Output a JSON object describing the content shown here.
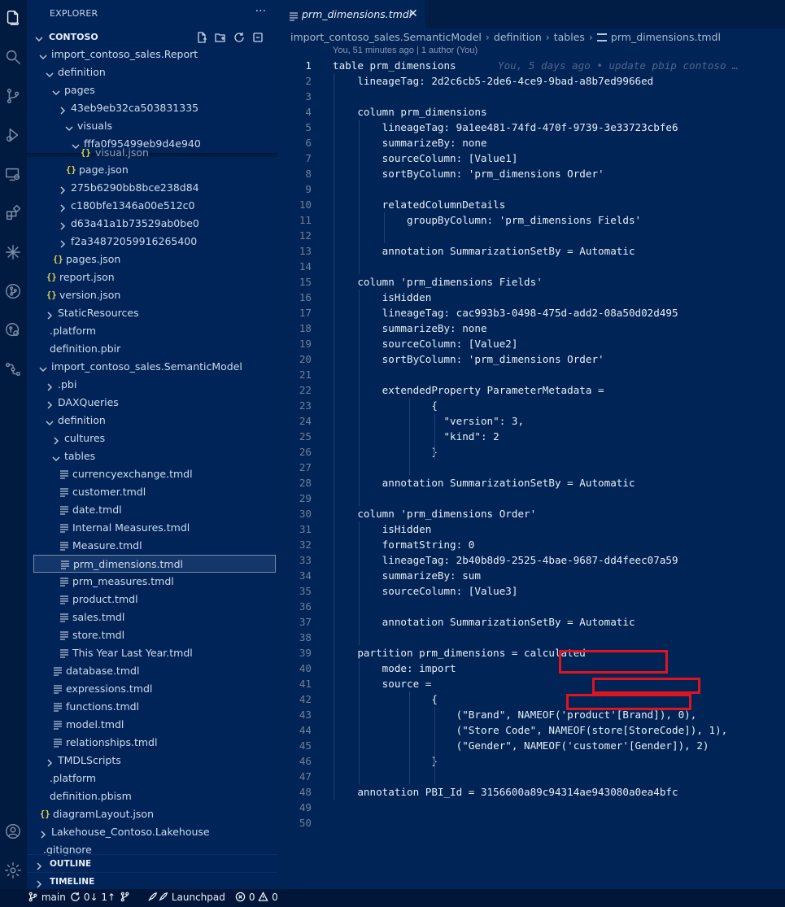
{
  "sidebar": {
    "title": "EXPLORER",
    "more": "···",
    "section_title": "CONTOSO",
    "tree": [
      {
        "label": "import_contoso_sales.Report",
        "type": "folder-open"
      },
      {
        "label": "definition",
        "type": "folder-open"
      },
      {
        "label": "pages",
        "type": "folder-open"
      },
      {
        "label": "43eb9eb32ca503831335",
        "type": "folder-closed"
      },
      {
        "label": "visuals",
        "type": "folder-open"
      },
      {
        "label": "fffa0f95499eb9d4e940",
        "type": "folder-open"
      },
      {
        "label": "page.json",
        "type": "json"
      },
      {
        "label": "275b6290bb8bce238d84",
        "type": "folder-closed"
      },
      {
        "label": "c180bfe1346a00e512c0",
        "type": "folder-closed"
      },
      {
        "label": "d63a41a1b73529ab0be0",
        "type": "folder-closed"
      },
      {
        "label": "f2a34872059916265400",
        "type": "folder-closed"
      },
      {
        "label": "pages.json",
        "type": "json"
      },
      {
        "label": "report.json",
        "type": "json"
      },
      {
        "label": "version.json",
        "type": "json"
      },
      {
        "label": "StaticResources",
        "type": "folder-closed"
      },
      {
        "label": ".platform",
        "type": "file"
      },
      {
        "label": "definition.pbir",
        "type": "file"
      },
      {
        "label": "import_contoso_sales.SemanticModel",
        "type": "folder-open"
      },
      {
        "label": ".pbi",
        "type": "folder-closed"
      },
      {
        "label": "DAXQueries",
        "type": "folder-closed"
      },
      {
        "label": "definition",
        "type": "folder-open"
      },
      {
        "label": "cultures",
        "type": "folder-closed"
      },
      {
        "label": "tables",
        "type": "folder-open"
      },
      {
        "label": "currencyexchange.tmdl",
        "type": "tmdl"
      },
      {
        "label": "customer.tmdl",
        "type": "tmdl"
      },
      {
        "label": "date.tmdl",
        "type": "tmdl"
      },
      {
        "label": "Internal Measures.tmdl",
        "type": "tmdl"
      },
      {
        "label": "Measure.tmdl",
        "type": "tmdl"
      },
      {
        "label": "prm_dimensions.tmdl",
        "type": "tmdl",
        "selected": true
      },
      {
        "label": "prm_measures.tmdl",
        "type": "tmdl"
      },
      {
        "label": "product.tmdl",
        "type": "tmdl"
      },
      {
        "label": "sales.tmdl",
        "type": "tmdl"
      },
      {
        "label": "store.tmdl",
        "type": "tmdl"
      },
      {
        "label": "This Year Last Year.tmdl",
        "type": "tmdl"
      },
      {
        "label": "database.tmdl",
        "type": "tmdl"
      },
      {
        "label": "expressions.tmdl",
        "type": "tmdl"
      },
      {
        "label": "functions.tmdl",
        "type": "tmdl"
      },
      {
        "label": "model.tmdl",
        "type": "tmdl"
      },
      {
        "label": "relationships.tmdl",
        "type": "tmdl"
      },
      {
        "label": "TMDLScripts",
        "type": "folder-closed"
      },
      {
        "label": ".platform",
        "type": "file"
      },
      {
        "label": "definition.pbism",
        "type": "file"
      },
      {
        "label": "diagramLayout.json",
        "type": "json"
      },
      {
        "label": "Lakehouse_Contoso.Lakehouse",
        "type": "folder-closed"
      },
      {
        "label": ".gitignore",
        "type": "file"
      }
    ],
    "peek_label": "visual.json",
    "outline": "OUTLINE",
    "timeline": "TIMELINE"
  },
  "editor": {
    "tab_label": "prm_dimensions.tmdl",
    "tab_close": "✕",
    "breadcrumb": [
      "import_contoso_sales.SemanticModel",
      "definition",
      "tables",
      "prm_dimensions.tmdl"
    ],
    "codelens": "You, 51 minutes ago | 1 author (You)",
    "blame": "You, 5 days ago • update pbip contoso …",
    "lines": [
      "table prm_dimensions",
      "    lineageTag: 2d2c6cb5-2de6-4ce9-9bad-a8b7ed9966ed",
      "",
      "    column prm_dimensions",
      "        lineageTag: 9a1ee481-74fd-470f-9739-3e33723cbfe6",
      "        summarizeBy: none",
      "        sourceColumn: [Value1]",
      "        sortByColumn: 'prm_dimensions Order'",
      "",
      "        relatedColumnDetails",
      "            groupByColumn: 'prm_dimensions Fields'",
      "",
      "        annotation SummarizationSetBy = Automatic",
      "",
      "    column 'prm_dimensions Fields'",
      "        isHidden",
      "        lineageTag: cac993b3-0498-475d-add2-08a50d02d495",
      "        summarizeBy: none",
      "        sourceColumn: [Value2]",
      "        sortByColumn: 'prm_dimensions Order'",
      "",
      "        extendedProperty ParameterMetadata =",
      "                {",
      "                  \"version\": 3,",
      "                  \"kind\": 2",
      "                }",
      "",
      "        annotation SummarizationSetBy = Automatic",
      "",
      "    column 'prm_dimensions Order'",
      "        isHidden",
      "        formatString: 0",
      "        lineageTag: 2b40b8d9-2525-4bae-9687-dd4feec07a59",
      "        summarizeBy: sum",
      "        sourceColumn: [Value3]",
      "",
      "        annotation SummarizationSetBy = Automatic",
      "",
      "    partition prm_dimensions = calculated",
      "        mode: import",
      "        source =",
      "                {",
      "                    (\"Brand\", NAMEOF('product'[Brand]), 0),",
      "                    (\"Store Code\", NAMEOF(store[StoreCode]), 1),",
      "                    (\"Gender\", NAMEOF('customer'[Gender]), 2)",
      "                }",
      "",
      "    annotation PBI_Id = 3156600a89c94314ae943080a0ea4bfc",
      "",
      ""
    ]
  },
  "statusbar": {
    "branch": "main",
    "sync": "0↓ 1↑",
    "launchpad": "Launchpad",
    "errors": "0",
    "warnings": "0"
  }
}
